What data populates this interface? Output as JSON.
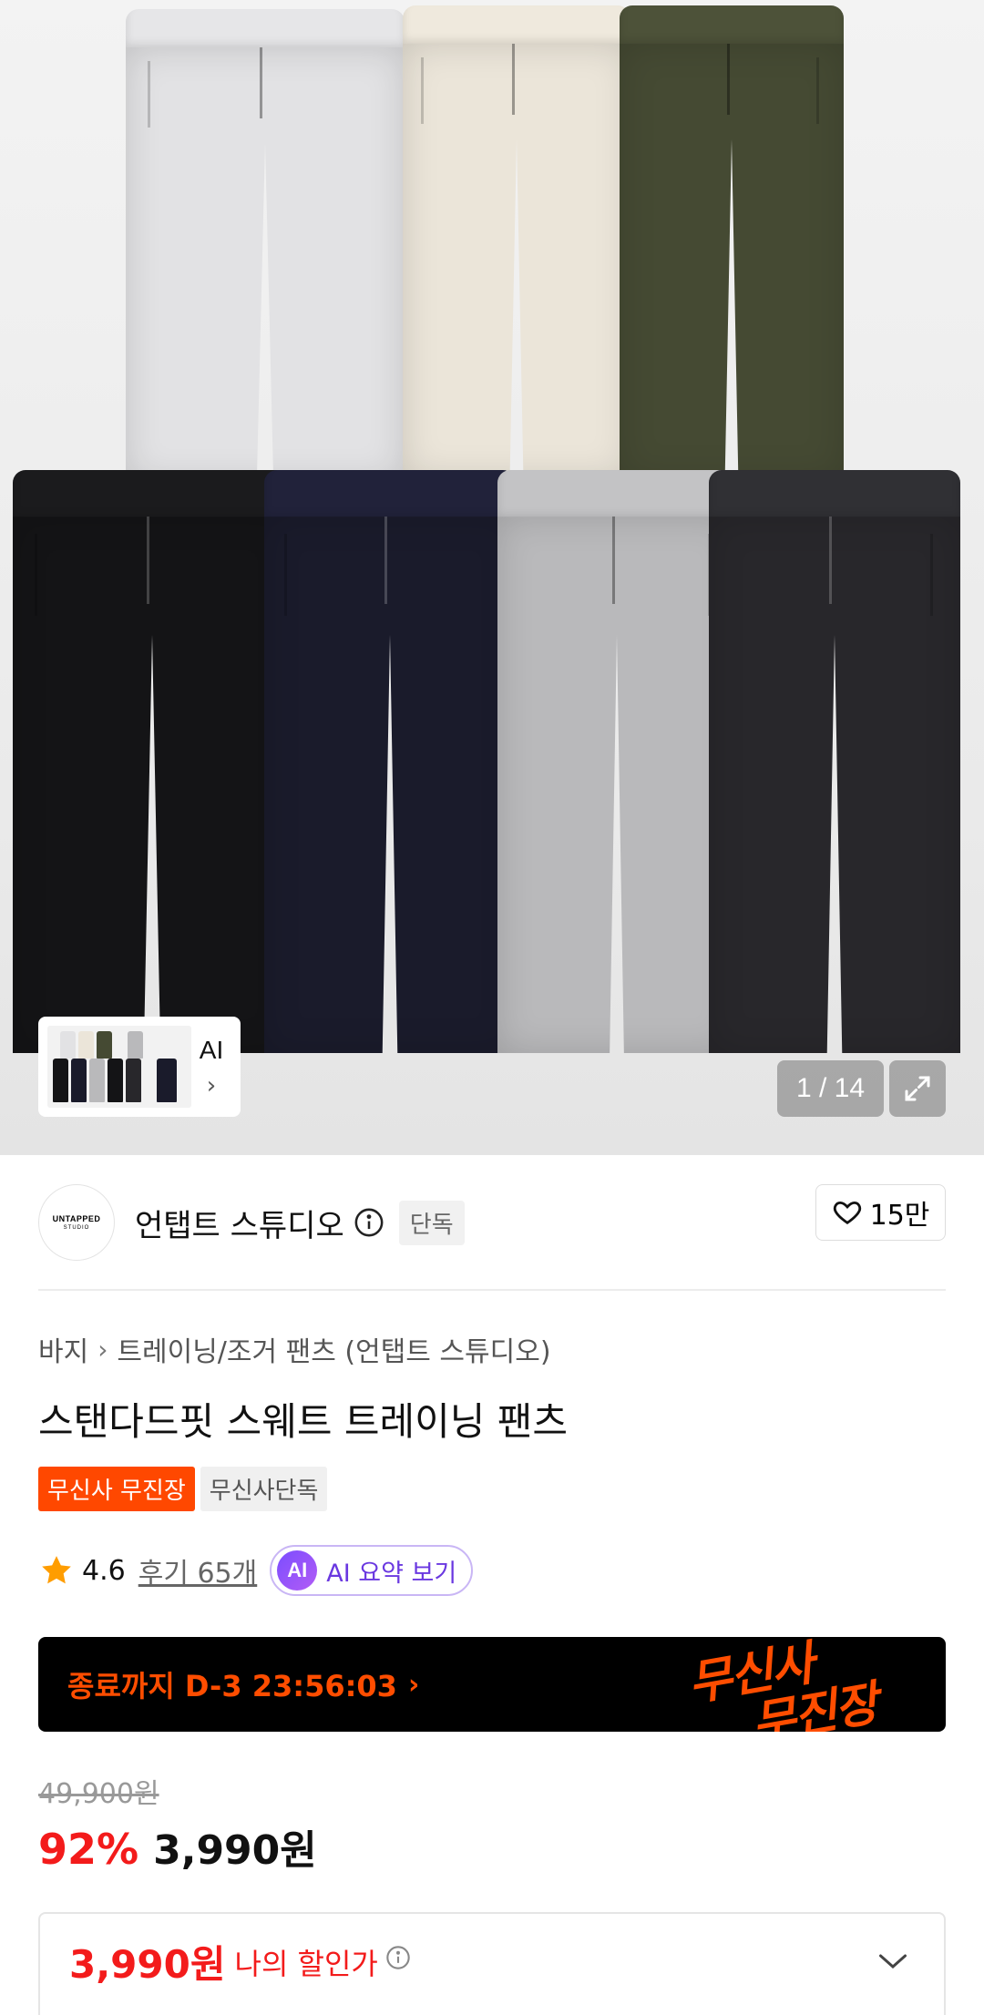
{
  "gallery": {
    "counter": "1 / 14",
    "thumbnail": {
      "label": "AI",
      "chevron": "›"
    }
  },
  "brand": {
    "logo_line1": "UNTAPPED",
    "logo_line2": "STUDIO",
    "name": "언탭트 스튜디오",
    "exclusive_tag": "단독",
    "like_count": "15만"
  },
  "breadcrumb": {
    "category": "바지",
    "separator": "›",
    "subcategory": "트레이닝/조거 팬츠 (언탭트 스튜디오)"
  },
  "product": {
    "title": "스탠다드핏 스웨트 트레이닝 팬츠",
    "tags": [
      "무신사 무진장",
      "무신사단독"
    ],
    "rating": "4.6",
    "review_link": "후기 65개",
    "ai_badge": "AI",
    "ai_summary_label": "AI 요약 보기"
  },
  "banner": {
    "timer_text": "종료까지 D-3 23:56:03",
    "chevron": "›",
    "logo_word1": "무신사",
    "logo_word2": "무진장"
  },
  "pricing": {
    "original_price": "49,900원",
    "discount": "92%",
    "final_price": "3,990원",
    "my_price": "3,990원",
    "my_price_label": "나의 할인가"
  },
  "colors": {
    "accent_orange": "#ff4800",
    "discount_red": "#f31b1b",
    "ai_purple": "#6a38e0",
    "pants": [
      "#e2e2e4",
      "#ebe5d9",
      "#454a33",
      "#141416",
      "#1a1b2b",
      "#b9b9bb",
      "#28272b"
    ]
  },
  "icons": [
    "info-icon",
    "heart-icon",
    "star-icon",
    "expand-icon",
    "chevron-down-icon"
  ]
}
